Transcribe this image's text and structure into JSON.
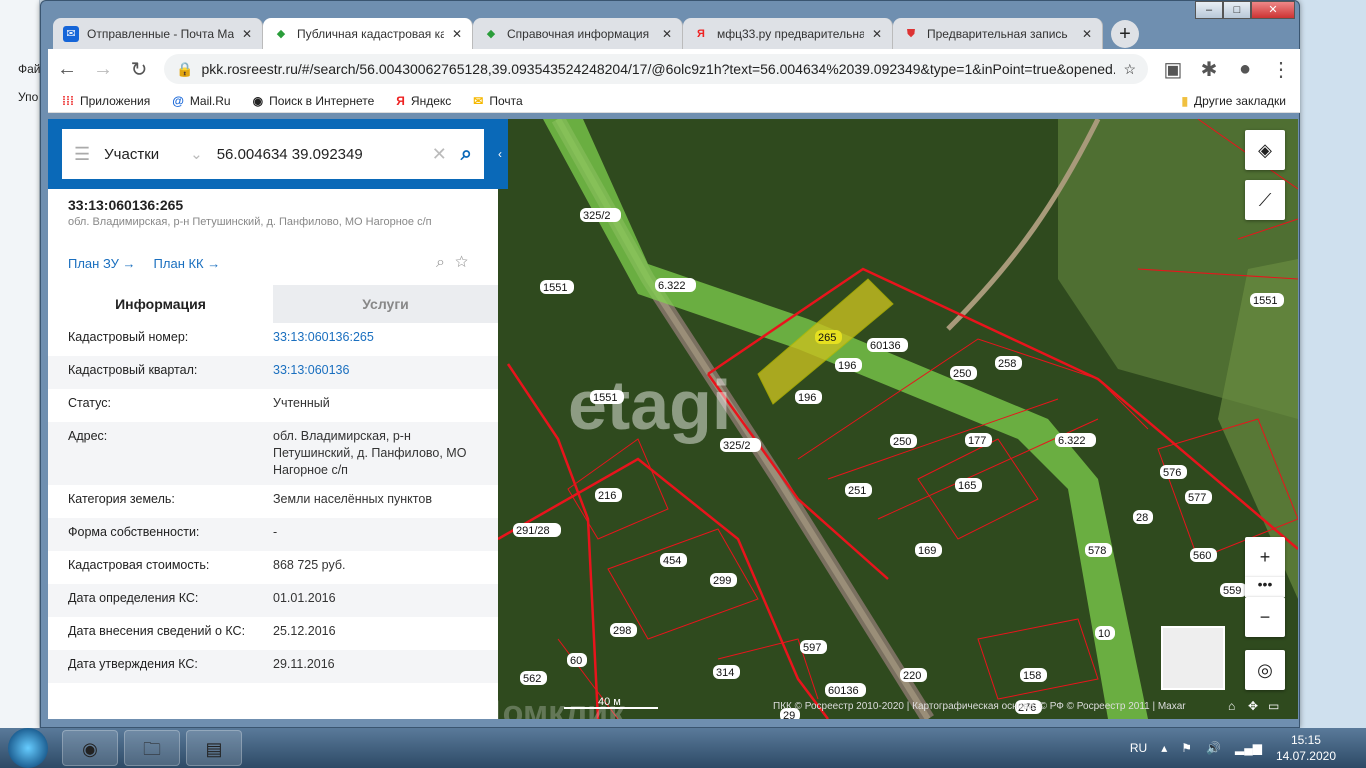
{
  "desktop": {
    "items": [
      "Фай",
      "Упо"
    ]
  },
  "browser": {
    "tabs": [
      {
        "label": "Отправленные - Почта Ма",
        "icon": "mail-icon"
      },
      {
        "label": "Публичная кадастровая ка",
        "icon": "pkk-icon"
      },
      {
        "label": "Справочная информация",
        "icon": "pkk-icon"
      },
      {
        "label": "мфц33.ру предварительна",
        "icon": "yandex-icon"
      },
      {
        "label": "Предварительная запись",
        "icon": "shield-icon"
      }
    ],
    "url": "pkk.rosreestr.ru/#/search/56.00430062765128,39.093543524248204/17/@6olc9z1h?text=56.004634%2039.092349&type=1&inPoint=true&opened...",
    "bookmarks": [
      "Приложения",
      "Mail.Ru",
      "Поиск в Интернете",
      "Яндекс",
      "Почта"
    ],
    "other_bookmarks": "Другие закладки"
  },
  "search": {
    "type": "Участки",
    "query": "56.004634 39.092349"
  },
  "object": {
    "number": "33:13:060136:265",
    "address": "обл. Владимирская, р-н Петушинский, д. Панфилово, МО Нагорное с/п",
    "links": [
      "План ЗУ →",
      "План КК →"
    ]
  },
  "tabs": {
    "info": "Информация",
    "services": "Услуги"
  },
  "rows": [
    {
      "k": "Кадастровый номер:",
      "v": "33:13:060136:265"
    },
    {
      "k": "Кадастровый квартал:",
      "v": "33:13:060136"
    },
    {
      "k": "Статус:",
      "v": "Учтенный"
    },
    {
      "k": "Адрес:",
      "v": "обл. Владимирская, р-н Петушинский, д. Панфилово, МО Нагорное с/п"
    },
    {
      "k": "Категория земель:",
      "v": "Земли населённых пунктов"
    },
    {
      "k": "Форма собственности:",
      "v": "-"
    },
    {
      "k": "Кадастровая стоимость:",
      "v": "868 725 руб."
    },
    {
      "k": "Дата определения КС:",
      "v": "01.01.2016"
    },
    {
      "k": "Дата внесения сведений о КС:",
      "v": "25.12.2016"
    },
    {
      "k": "Дата утверждения КС:",
      "v": "29.11.2016"
    }
  ],
  "map": {
    "labels": [
      "265",
      "60136",
      "196",
      "196",
      "250",
      "258",
      "250",
      "177",
      "6.322",
      "6.322",
      "1551",
      "1551",
      "1551",
      "325/2",
      "325/2",
      "216",
      "291/28",
      "251",
      "165",
      "169",
      "454",
      "299",
      "298",
      "576",
      "577",
      "28",
      "560",
      "578",
      "559",
      "10",
      "597",
      "314",
      "60",
      "562",
      "158",
      "220",
      "60136",
      "276",
      "29"
    ],
    "scale": "40 м",
    "attribution": "ПКК © Росреестр 2010-2020 | Картографическая основа: © РФ © Росреестр 2011 | Maxar",
    "watermark": "etagi",
    "watermark2": "Домклик"
  },
  "taskbar": {
    "lang": "RU",
    "time": "15:15",
    "date": "14.07.2020"
  }
}
